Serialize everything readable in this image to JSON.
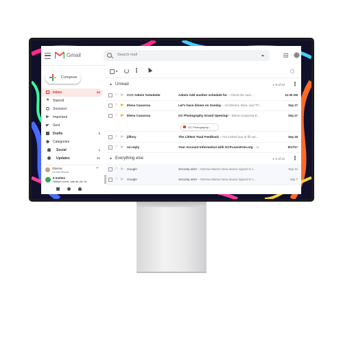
{
  "app": {
    "brand": "Gmail"
  },
  "search": {
    "placeholder": "Search mail"
  },
  "sidebar": {
    "compose_label": "Compose",
    "items": [
      {
        "label": "Inbox",
        "count": "54",
        "icon": "inbox-icon"
      },
      {
        "label": "Starred",
        "count": "",
        "icon": "star-icon"
      },
      {
        "label": "Snoozed",
        "count": "",
        "icon": "clock-icon"
      },
      {
        "label": "Important",
        "count": "",
        "icon": "important-icon"
      },
      {
        "label": "Sent",
        "count": "",
        "icon": "send-icon"
      },
      {
        "label": "Drafts",
        "count": "5",
        "icon": "draft-icon"
      },
      {
        "label": "Categories",
        "count": "",
        "icon": "label-icon"
      },
      {
        "label": "Social",
        "count": "1",
        "icon": "people-icon"
      },
      {
        "label": "Updates",
        "count": "31",
        "icon": "info-icon"
      }
    ],
    "hangouts": {
      "user_name": "Glenna",
      "user_status": "No hat Beluna",
      "invites_title": "5 Invites",
      "invites_names": "William Lionel, zakrdh_lisi, M..."
    }
  },
  "toolbar": {
    "pagination": "1–9 of 54"
  },
  "sections": {
    "unread": {
      "title": "Unread",
      "range": "1–9 of 54"
    },
    "everything": {
      "title": "Everything else",
      "range": "1–2 of 12"
    }
  },
  "emails": [
    {
      "sender": "CCC Admin Scheduler",
      "subject": "Admin Add another schedule for",
      "snippet": " – check the new...",
      "date": "11:30 AM",
      "important": false,
      "read": false
    },
    {
      "sender": "Elena Casarosa",
      "subject": "Let's have dinner on Sunday",
      "snippet": " – Hi Glenna, Silva, and TT...",
      "date": "Sep 27",
      "important": true,
      "read": false
    },
    {
      "sender": "Elena Casarosa",
      "subject": "GC Photography Grand Opening!",
      "snippet": " – Elena Casarosa E...",
      "date": "Sep 27",
      "important": true,
      "read": false,
      "attachment": "GC Photography..."
    },
    {
      "sender": "jilllory",
      "subject": "The Littlest Toad Feedback",
      "snippet": " – I've invited you to fill out...",
      "date": "Sep 18",
      "important": false,
      "read": false
    },
    {
      "sender": "no-reply",
      "subject": "Your Account Information with GCFLearnFree.org",
      "snippet": " – H...",
      "date": "9/17/17",
      "important": false,
      "read": false
    }
  ],
  "other_emails": [
    {
      "sender": "Google",
      "subject": "Security alert",
      "snippet": " – Glenna Mason New device signed in t...",
      "date": "Sep 12"
    },
    {
      "sender": "Google",
      "subject": "Security alert",
      "snippet": " – Glenna Mason New device signed in t...",
      "date": "Sep 7"
    }
  ],
  "colors": {
    "accent": "#d93025",
    "important": "#f4b400",
    "compose_red": "#ea4335",
    "compose_green": "#34a853",
    "compose_blue": "#4285f4",
    "compose_yellow": "#fbbc04"
  }
}
